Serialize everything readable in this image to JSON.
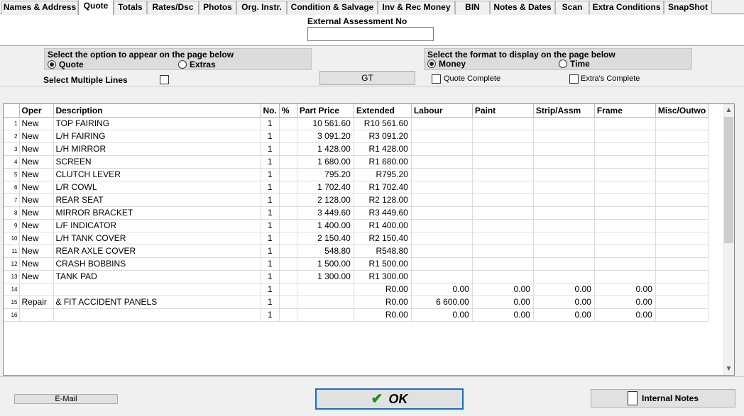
{
  "tabs": [
    {
      "label": "Names & Address",
      "active": false
    },
    {
      "label": "Quote",
      "active": true
    },
    {
      "label": "Totals",
      "active": false
    },
    {
      "label": "Rates/Dsc",
      "active": false
    },
    {
      "label": "Photos",
      "active": false
    },
    {
      "label": "Org. Instr.",
      "active": false
    },
    {
      "label": "Condition & Salvage",
      "active": false
    },
    {
      "label": "Inv & Rec Money",
      "active": false
    },
    {
      "label": "BIN",
      "active": false
    },
    {
      "label": "Notes & Dates",
      "active": false
    },
    {
      "label": "Scan",
      "active": false
    },
    {
      "label": "Extra Conditions",
      "active": false
    },
    {
      "label": "SnapShot",
      "active": false
    }
  ],
  "external": {
    "label": "External Assessment No",
    "value": ""
  },
  "option_group": {
    "title": "Select the option to appear on the page below",
    "options": [
      {
        "label": "Quote",
        "selected": true
      },
      {
        "label": "Extras",
        "selected": false
      }
    ]
  },
  "format_group": {
    "title": "Select the format to display on the page below",
    "options": [
      {
        "label": "Money",
        "selected": true
      },
      {
        "label": "Time",
        "selected": false
      }
    ]
  },
  "multi_lines": {
    "label": "Select Multiple Lines",
    "checked": false
  },
  "gt_button": "GT",
  "quote_complete": {
    "label": "Quote Complete",
    "checked": false
  },
  "extras_complete": {
    "label": "Extra's Complete",
    "checked": false
  },
  "grid": {
    "columns": [
      "",
      "Oper",
      "Description",
      "No.",
      "%",
      "Part Price",
      "Extended",
      "Labour",
      "Paint",
      "Strip/Assm",
      "Frame",
      "Misc/Outwo"
    ],
    "rows": [
      [
        "1",
        "New",
        "TOP FAIRING",
        "1",
        "",
        "10 561.60",
        "R10 561.60",
        "",
        "",
        "",
        "",
        ""
      ],
      [
        "2",
        "New",
        "L/H FAIRING",
        "1",
        "",
        "3 091.20",
        "R3 091.20",
        "",
        "",
        "",
        "",
        ""
      ],
      [
        "3",
        "New",
        "L/H MIRROR",
        "1",
        "",
        "1 428.00",
        "R1 428.00",
        "",
        "",
        "",
        "",
        ""
      ],
      [
        "4",
        "New",
        "SCREEN",
        "1",
        "",
        "1 680.00",
        "R1 680.00",
        "",
        "",
        "",
        "",
        ""
      ],
      [
        "5",
        "New",
        "CLUTCH LEVER",
        "1",
        "",
        "795.20",
        "R795.20",
        "",
        "",
        "",
        "",
        ""
      ],
      [
        "6",
        "New",
        "L/R COWL",
        "1",
        "",
        "1 702.40",
        "R1 702.40",
        "",
        "",
        "",
        "",
        ""
      ],
      [
        "7",
        "New",
        "REAR SEAT",
        "1",
        "",
        "2 128.00",
        "R2 128.00",
        "",
        "",
        "",
        "",
        ""
      ],
      [
        "8",
        "New",
        "MIRROR BRACKET",
        "1",
        "",
        "3 449.60",
        "R3 449.60",
        "",
        "",
        "",
        "",
        ""
      ],
      [
        "9",
        "New",
        "L/F INDICATOR",
        "1",
        "",
        "1 400.00",
        "R1 400.00",
        "",
        "",
        "",
        "",
        ""
      ],
      [
        "10",
        "New",
        "L/H TANK COVER",
        "1",
        "",
        "2 150.40",
        "R2 150.40",
        "",
        "",
        "",
        "",
        ""
      ],
      [
        "11",
        "New",
        "REAR AXLE COVER",
        "1",
        "",
        "548.80",
        "R548.80",
        "",
        "",
        "",
        "",
        ""
      ],
      [
        "12",
        "New",
        "CRASH BOBBINS",
        "1",
        "",
        "1 500.00",
        "R1 500.00",
        "",
        "",
        "",
        "",
        ""
      ],
      [
        "13",
        "New",
        "TANK PAD",
        "1",
        "",
        "1 300.00",
        "R1 300.00",
        "",
        "",
        "",
        "",
        ""
      ],
      [
        "14",
        "",
        "",
        "1",
        "",
        "",
        "R0.00",
        "0.00",
        "0.00",
        "0.00",
        "0.00",
        ""
      ],
      [
        "15",
        "Repair",
        "& FIT ACCIDENT PANELS",
        "1",
        "",
        "",
        "R0.00",
        "6 600.00",
        "0.00",
        "0.00",
        "0.00",
        ""
      ],
      [
        "16",
        "",
        "",
        "1",
        "",
        "",
        "R0.00",
        "0.00",
        "0.00",
        "0.00",
        "0.00",
        ""
      ]
    ]
  },
  "email_button": "E-Mail",
  "ok_button": "OK",
  "internal_notes_button": "Internal Notes",
  "colors": {
    "ok_border": "#1a6fc9",
    "check_green": "#1c8a1c"
  }
}
